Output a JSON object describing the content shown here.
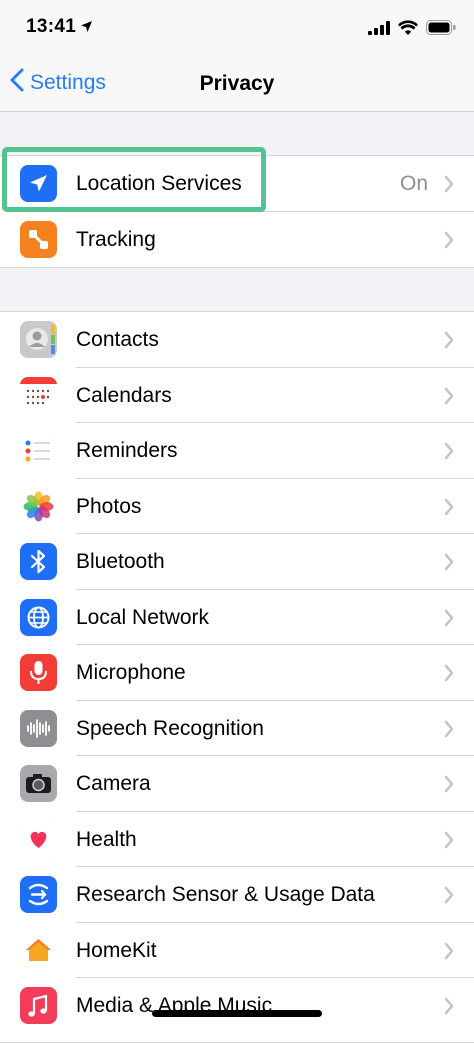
{
  "status_bar": {
    "time": "13:41"
  },
  "nav": {
    "back_label": "Settings",
    "title": "Privacy"
  },
  "section1": [
    {
      "label": "Location Services",
      "value": "On",
      "icon": "location-arrow-icon",
      "color": "#1e6ff5"
    },
    {
      "label": "Tracking",
      "value": "",
      "icon": "tracking-icon",
      "color": "#f5821f"
    }
  ],
  "section2": [
    {
      "label": "Contacts",
      "icon": "contacts-icon",
      "color": "#b9b9b9"
    },
    {
      "label": "Calendars",
      "icon": "calendar-icon",
      "color": "#ffffff"
    },
    {
      "label": "Reminders",
      "icon": "reminders-icon",
      "color": "#ffffff"
    },
    {
      "label": "Photos",
      "icon": "photos-icon",
      "color": "#ffffff"
    },
    {
      "label": "Bluetooth",
      "icon": "bluetooth-icon",
      "color": "#1e6ff5"
    },
    {
      "label": "Local Network",
      "icon": "globe-icon",
      "color": "#1e6ff5"
    },
    {
      "label": "Microphone",
      "icon": "microphone-icon",
      "color": "#f23c35"
    },
    {
      "label": "Speech Recognition",
      "icon": "waveform-icon",
      "color": "#8e8e93"
    },
    {
      "label": "Camera",
      "icon": "camera-icon",
      "color": "#8e8e93"
    },
    {
      "label": "Health",
      "icon": "heart-icon",
      "color": "#ffffff"
    },
    {
      "label": "Research Sensor & Usage Data",
      "icon": "research-icon",
      "color": "#1e6ff5"
    },
    {
      "label": "HomeKit",
      "icon": "home-icon",
      "color": "#ffffff"
    },
    {
      "label": "Media & Apple Music",
      "icon": "music-note-icon",
      "color": "#f23c5a"
    }
  ]
}
